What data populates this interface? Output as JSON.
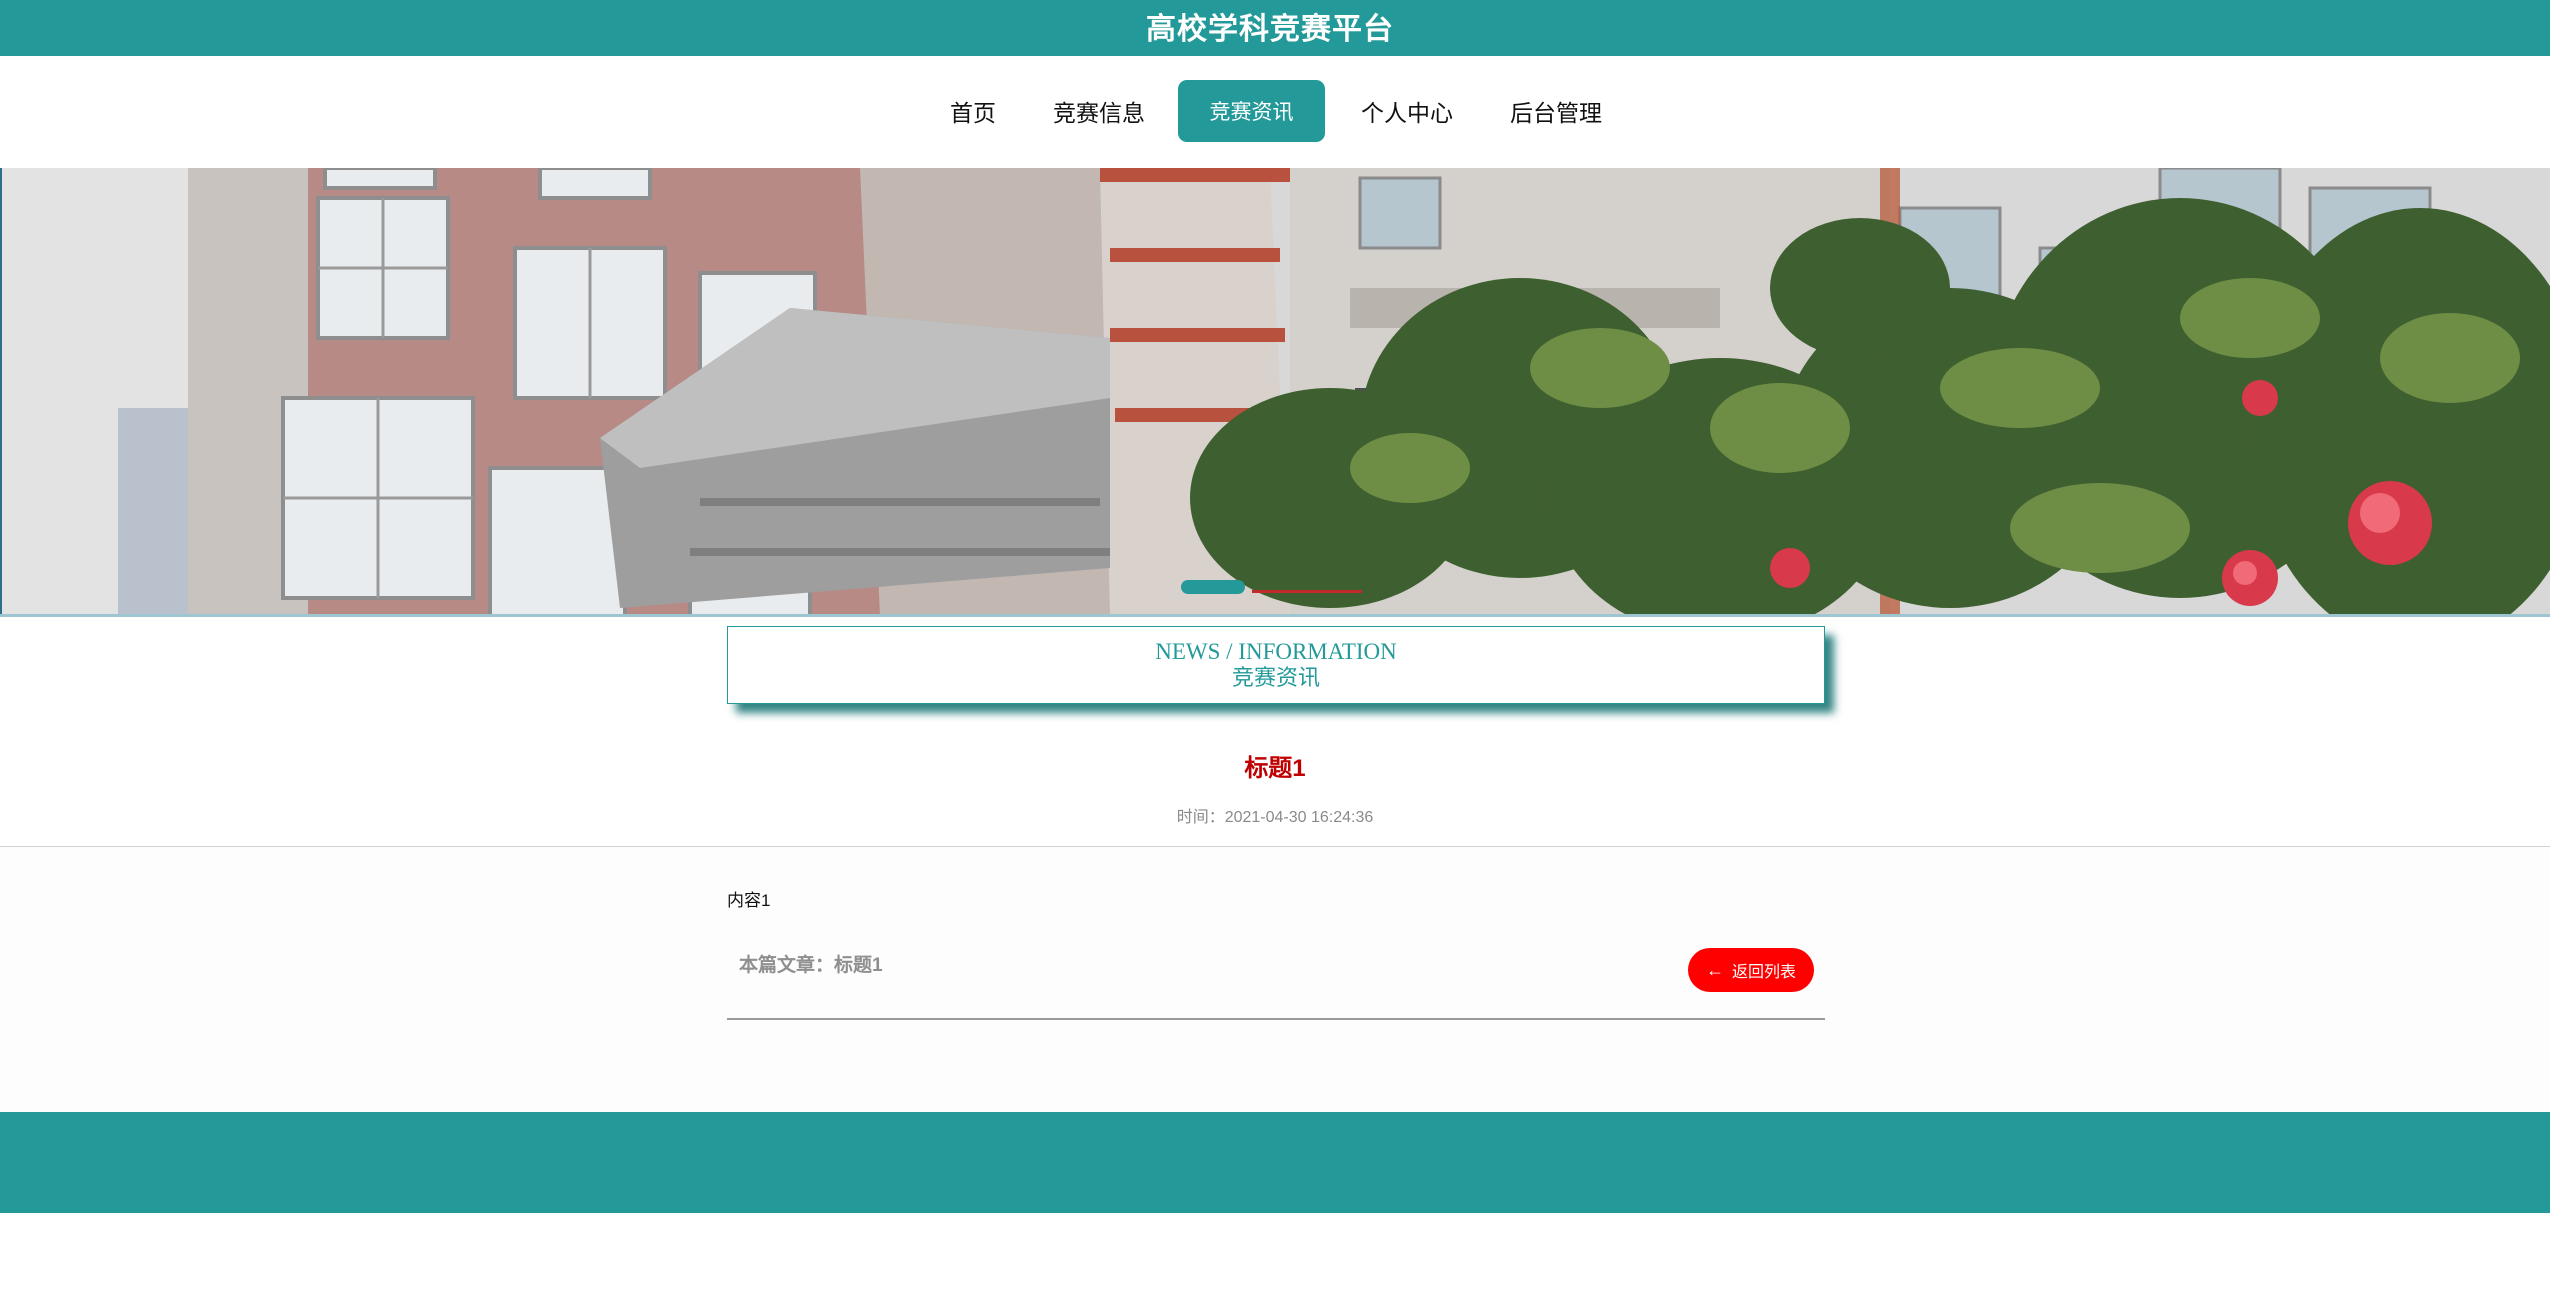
{
  "header": {
    "site_title": "高校学科竞赛平台"
  },
  "nav": {
    "items": [
      {
        "label": "首页"
      },
      {
        "label": "竞赛信息"
      },
      {
        "label": "竞赛资讯"
      },
      {
        "label": "个人中心"
      },
      {
        "label": "后台管理"
      }
    ],
    "active": "竞赛资讯"
  },
  "section": {
    "title_en": "NEWS / INFORMATION",
    "title_cn": "竞赛资讯"
  },
  "article": {
    "title": "标题1",
    "time": "时间：2021-04-30 16:24:36",
    "content": "内容1",
    "current_label": "本篇文章：标题1",
    "back_label": "返回列表"
  },
  "colors": {
    "primary": "#239a99",
    "title_red": "#c00000",
    "button_red": "#ff0000"
  },
  "carousel": {
    "slide_count": 2,
    "active_slide": 1
  }
}
